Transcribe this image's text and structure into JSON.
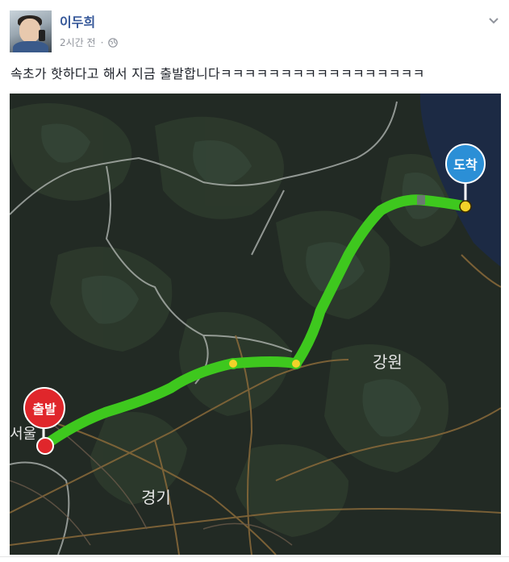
{
  "post": {
    "author": "이두희",
    "timestamp": "2시간 전",
    "privacy_icon": "globe-icon",
    "options_icon": "chevron-down-icon",
    "text": "속초가 핫하다고 해서 지금 출발합니다ㅋㅋㅋㅋㅋㅋㅋㅋㅋㅋㅋㅋㅋㅋㅋㅋㅋ"
  },
  "map": {
    "start_label": "출발",
    "end_label": "도착",
    "city_label": "서울",
    "region_east": "강원",
    "region_west": "경기",
    "route_color": "#3ec81e",
    "start_color": "#e0262b",
    "end_color": "#2b8fd6",
    "sea_color": "#1c2a44"
  }
}
